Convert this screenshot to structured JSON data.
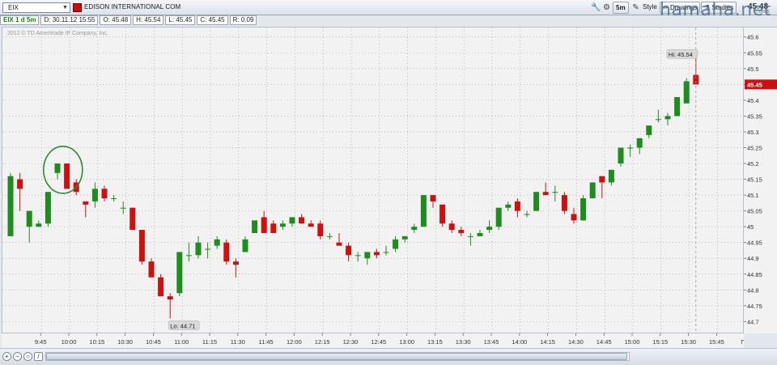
{
  "toolbar": {
    "symbol": "EIX",
    "company": "EDISON INTERNATIONAL COM",
    "timeframe_label": "5m",
    "style_label": "Style",
    "drawings_label": "Drawings",
    "studies_label": "Studies",
    "last_price": "45.48",
    "last_price_sub": "0.005",
    "symbol_color": "#c90c0c"
  },
  "infobar": {
    "symbol_period": "EIX 1 d 5m",
    "date": "D: 30.11.12 15:55",
    "open": "O: 45.48",
    "high": "H: 45.54",
    "low": "L: 45.45",
    "close": "C: 45.45",
    "range": "R: 0.09"
  },
  "chart": {
    "copyright": "2012 © TD Ameritrade IP Company, Inc.",
    "hi_label": "Hi: 45.54",
    "lo_label": "Lo: 44.71",
    "price_tag": "45.45"
  },
  "chart_data": {
    "type": "candlestick",
    "up_color": "#1e8c1e",
    "down_color": "#cc1111",
    "ylim": [
      44.66,
      45.63
    ],
    "yticks": [
      "45.6",
      "45.55",
      "45.5",
      "45.45",
      "45.4",
      "45.35",
      "45.3",
      "45.25",
      "45.2",
      "45.15",
      "45.1",
      "45.05",
      "45",
      "44.95",
      "44.9",
      "44.85",
      "44.8",
      "44.75",
      "44.7"
    ],
    "xticks": [
      "9:45",
      "10:00",
      "10:15",
      "10:30",
      "10:45",
      "11:00",
      "11:15",
      "11:30",
      "11:45",
      "12:00",
      "12:15",
      "12:30",
      "12:45",
      "13:00",
      "13:15",
      "13:30",
      "13:45",
      "14:00",
      "14:15",
      "14:30",
      "14:45",
      "15:00",
      "15:15",
      "15:30",
      "15:45",
      "Пн"
    ],
    "candles": [
      {
        "o": 44.97,
        "h": 45.17,
        "l": 44.97,
        "c": 45.16
      },
      {
        "o": 45.15,
        "h": 45.17,
        "l": 45.05,
        "c": 45.12
      },
      {
        "o": 45.0,
        "h": 45.01,
        "l": 44.95,
        "c": 45.05
      },
      {
        "o": 45.0,
        "h": 45.02,
        "l": 45.0,
        "c": 45.01
      },
      {
        "o": 45.01,
        "h": 45.11,
        "l": 45.0,
        "c": 45.11
      },
      {
        "o": 45.17,
        "h": 45.2,
        "l": 45.15,
        "c": 45.2
      },
      {
        "o": 45.2,
        "h": 45.2,
        "l": 45.12,
        "c": 45.12
      },
      {
        "o": 45.14,
        "h": 45.15,
        "l": 45.1,
        "c": 45.11
      },
      {
        "o": 45.08,
        "h": 45.08,
        "l": 45.03,
        "c": 45.07
      },
      {
        "o": 45.08,
        "h": 45.14,
        "l": 45.06,
        "c": 45.12
      },
      {
        "o": 45.12,
        "h": 45.13,
        "l": 45.08,
        "c": 45.09
      },
      {
        "o": 45.09,
        "h": 45.1,
        "l": 45.08,
        "c": 45.09
      },
      {
        "o": 45.06,
        "h": 45.08,
        "l": 45.04,
        "c": 45.06
      },
      {
        "o": 45.06,
        "h": 45.06,
        "l": 44.99,
        "c": 44.99
      },
      {
        "o": 44.99,
        "h": 44.99,
        "l": 44.88,
        "c": 44.89
      },
      {
        "o": 44.89,
        "h": 44.9,
        "l": 44.84,
        "c": 44.84
      },
      {
        "o": 44.84,
        "h": 44.85,
        "l": 44.78,
        "c": 44.78
      },
      {
        "o": 44.78,
        "h": 44.79,
        "l": 44.71,
        "c": 44.77
      },
      {
        "o": 44.79,
        "h": 44.92,
        "l": 44.78,
        "c": 44.92
      },
      {
        "o": 44.91,
        "h": 44.95,
        "l": 44.89,
        "c": 44.91
      },
      {
        "o": 44.91,
        "h": 44.97,
        "l": 44.9,
        "c": 44.95
      },
      {
        "o": 44.93,
        "h": 44.95,
        "l": 44.9,
        "c": 44.93
      },
      {
        "o": 44.94,
        "h": 44.97,
        "l": 44.93,
        "c": 44.96
      },
      {
        "o": 44.95,
        "h": 44.96,
        "l": 44.88,
        "c": 44.89
      },
      {
        "o": 44.89,
        "h": 44.9,
        "l": 44.84,
        "c": 44.88
      },
      {
        "o": 44.92,
        "h": 44.97,
        "l": 44.92,
        "c": 44.96
      },
      {
        "o": 44.98,
        "h": 45.02,
        "l": 44.98,
        "c": 45.02
      },
      {
        "o": 45.03,
        "h": 45.05,
        "l": 44.98,
        "c": 44.98
      },
      {
        "o": 45.01,
        "h": 45.02,
        "l": 44.98,
        "c": 44.98
      },
      {
        "o": 45.0,
        "h": 45.02,
        "l": 44.99,
        "c": 45.01
      },
      {
        "o": 45.01,
        "h": 45.03,
        "l": 45.0,
        "c": 45.03
      },
      {
        "o": 45.03,
        "h": 45.04,
        "l": 45.01,
        "c": 45.01
      },
      {
        "o": 45.01,
        "h": 45.02,
        "l": 45.0,
        "c": 45.0
      },
      {
        "o": 45.01,
        "h": 45.02,
        "l": 44.96,
        "c": 44.97
      },
      {
        "o": 44.97,
        "h": 44.98,
        "l": 44.96,
        "c": 44.97
      },
      {
        "o": 44.95,
        "h": 44.98,
        "l": 44.94,
        "c": 44.94
      },
      {
        "o": 44.94,
        "h": 44.95,
        "l": 44.89,
        "c": 44.91
      },
      {
        "o": 44.91,
        "h": 44.92,
        "l": 44.89,
        "c": 44.91
      },
      {
        "o": 44.9,
        "h": 44.92,
        "l": 44.88,
        "c": 44.92
      },
      {
        "o": 44.92,
        "h": 44.93,
        "l": 44.9,
        "c": 44.91
      },
      {
        "o": 44.92,
        "h": 44.94,
        "l": 44.91,
        "c": 44.92
      },
      {
        "o": 44.93,
        "h": 44.97,
        "l": 44.92,
        "c": 44.96
      },
      {
        "o": 44.96,
        "h": 44.97,
        "l": 44.95,
        "c": 44.97
      },
      {
        "o": 44.99,
        "h": 45.01,
        "l": 44.98,
        "c": 45.0
      },
      {
        "o": 45.0,
        "h": 45.1,
        "l": 45.0,
        "c": 45.1
      },
      {
        "o": 45.1,
        "h": 45.1,
        "l": 45.06,
        "c": 45.08
      },
      {
        "o": 45.07,
        "h": 45.07,
        "l": 45.0,
        "c": 45.01
      },
      {
        "o": 45.01,
        "h": 45.02,
        "l": 44.98,
        "c": 44.99
      },
      {
        "o": 44.99,
        "h": 45.0,
        "l": 44.97,
        "c": 44.98
      },
      {
        "o": 44.97,
        "h": 44.98,
        "l": 44.94,
        "c": 44.97
      },
      {
        "o": 44.97,
        "h": 44.99,
        "l": 44.97,
        "c": 44.98
      },
      {
        "o": 44.99,
        "h": 45.02,
        "l": 44.98,
        "c": 45.0
      },
      {
        "o": 45.0,
        "h": 45.06,
        "l": 44.99,
        "c": 45.06
      },
      {
        "o": 45.06,
        "h": 45.08,
        "l": 45.05,
        "c": 45.07
      },
      {
        "o": 45.08,
        "h": 45.09,
        "l": 45.03,
        "c": 45.05
      },
      {
        "o": 45.04,
        "h": 45.05,
        "l": 45.03,
        "c": 45.04
      },
      {
        "o": 45.05,
        "h": 45.11,
        "l": 45.05,
        "c": 45.11
      },
      {
        "o": 45.11,
        "h": 45.14,
        "l": 45.1,
        "c": 45.1
      },
      {
        "o": 45.11,
        "h": 45.13,
        "l": 45.08,
        "c": 45.11
      },
      {
        "o": 45.1,
        "h": 45.11,
        "l": 45.04,
        "c": 45.05
      },
      {
        "o": 45.04,
        "h": 45.06,
        "l": 45.01,
        "c": 45.02
      },
      {
        "o": 45.02,
        "h": 45.1,
        "l": 45.02,
        "c": 45.09
      },
      {
        "o": 45.09,
        "h": 45.14,
        "l": 45.09,
        "c": 45.14
      },
      {
        "o": 45.16,
        "h": 45.16,
        "l": 45.09,
        "c": 45.14
      },
      {
        "o": 45.14,
        "h": 45.18,
        "l": 45.13,
        "c": 45.18
      },
      {
        "o": 45.2,
        "h": 45.25,
        "l": 45.19,
        "c": 45.25
      },
      {
        "o": 45.25,
        "h": 45.26,
        "l": 45.22,
        "c": 45.25
      },
      {
        "o": 45.25,
        "h": 45.28,
        "l": 45.23,
        "c": 45.28
      },
      {
        "o": 45.29,
        "h": 45.32,
        "l": 45.28,
        "c": 45.32
      },
      {
        "o": 45.34,
        "h": 45.37,
        "l": 45.33,
        "c": 45.34
      },
      {
        "o": 45.34,
        "h": 45.36,
        "l": 45.32,
        "c": 45.35
      },
      {
        "o": 45.35,
        "h": 45.41,
        "l": 45.35,
        "c": 45.41
      },
      {
        "o": 45.39,
        "h": 45.47,
        "l": 45.39,
        "c": 45.46
      },
      {
        "o": 45.48,
        "h": 45.54,
        "l": 45.45,
        "c": 45.45
      }
    ]
  }
}
